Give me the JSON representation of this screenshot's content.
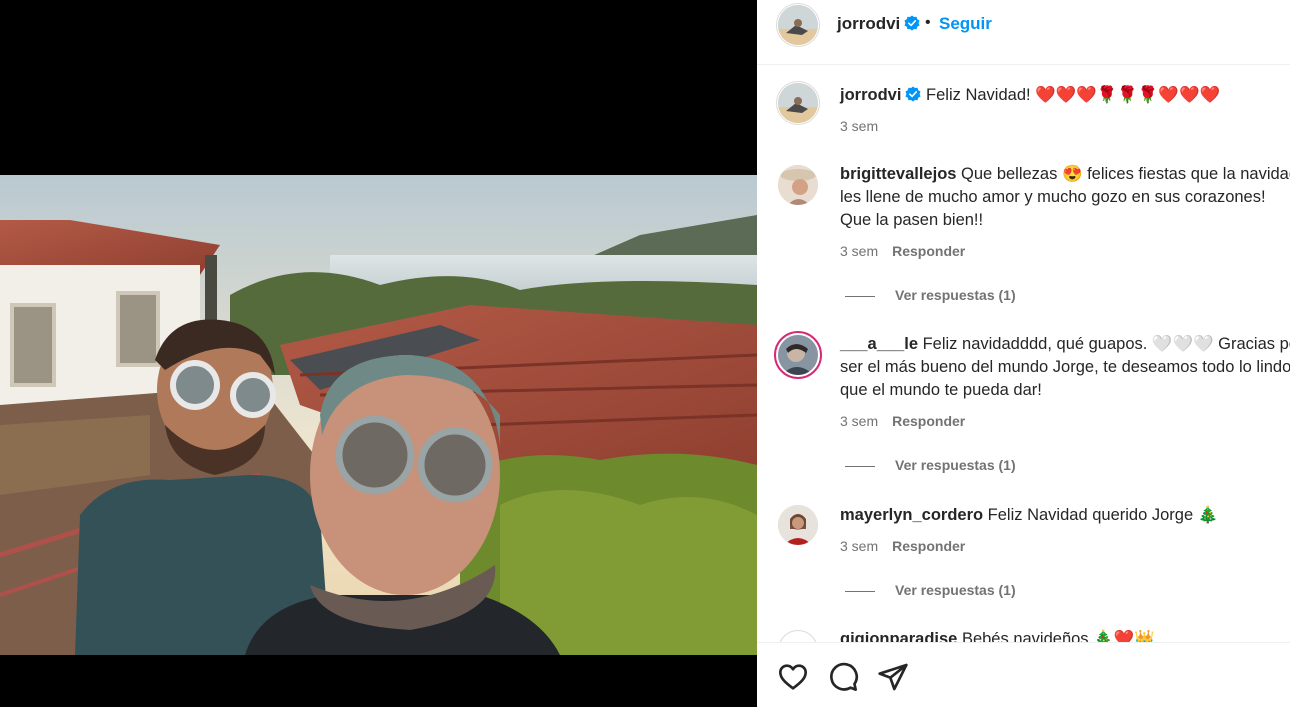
{
  "post": {
    "username": "jorrodvi",
    "follow_label": "Seguir",
    "dot": "•",
    "caption_text": "Feliz Navidad! ❤️❤️❤️🌹🌹🌹❤️❤️❤️",
    "caption_time": "3 sem"
  },
  "comments": [
    {
      "username": "brigittevallejos",
      "lines": [
        "Que bellezas 😍 felices fiestas que la navidad",
        "les llene de mucho amor y mucho gozo en sus corazones!",
        "Que la pasen bien!!"
      ],
      "time": "3 sem",
      "reply_label": "Responder",
      "replies_label": "Ver respuestas (1)"
    },
    {
      "username": "___a___le",
      "lines": [
        "Feliz navidadddd, qué guapos. 🤍🤍🤍 Gracias por",
        "ser el más bueno del mundo Jorge, te deseamos todo lo lindo",
        "que el mundo te pueda dar!"
      ],
      "time": "3 sem",
      "reply_label": "Responder",
      "replies_label": "Ver respuestas (1)"
    },
    {
      "username": "mayerlyn_cordero",
      "lines": [
        "Feliz Navidad querido Jorge 🎄"
      ],
      "time": "3 sem",
      "reply_label": "Responder",
      "replies_label": "Ver respuestas (1)"
    },
    {
      "username": "gigionparadise",
      "lines": [
        "Bebés navideños 🎄❤️👑"
      ]
    }
  ],
  "icons": {
    "like": "heart-icon",
    "comment": "comment-icon",
    "share": "send-icon",
    "verified": "verified-badge-icon"
  },
  "colors": {
    "accent": "#0095f6",
    "verified": "#0095f6",
    "muted": "#737373",
    "text": "#262626"
  }
}
